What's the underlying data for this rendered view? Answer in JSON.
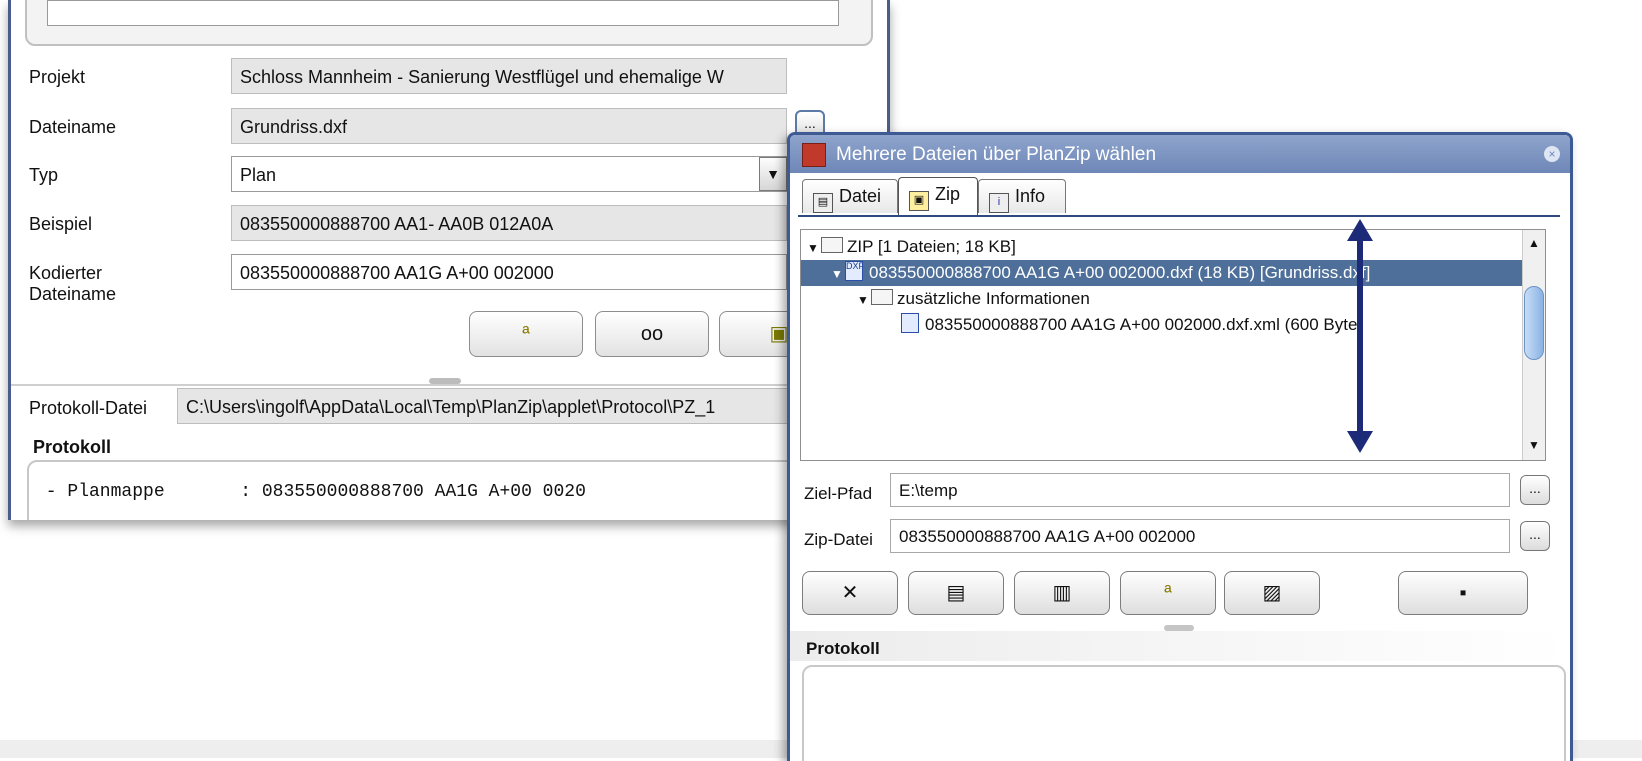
{
  "main": {
    "labels": {
      "project": "Projekt",
      "filename": "Dateiname",
      "type": "Typ",
      "example": "Beispiel",
      "encoded": "Kodierter Dateiname",
      "protocol_file": "Protokoll-Datei",
      "protocol": "Protokoll"
    },
    "values": {
      "project": "Schloss Mannheim - Sanierung Westflügel und ehemalige W",
      "filename": "Grundriss.dxf",
      "type": "Plan",
      "example": "083550000888700 AA1- AA0B 012A0A",
      "encoded": "083550000888700 AA1G A+00 002000",
      "protocol_file": "C:\\Users\\ingolf\\AppData\\Local\\Temp\\PlanZip\\applet\\Protocol\\PZ_1",
      "protocol_line": " - Planmappe       : 083550000888700 AA1G A+00 0020"
    },
    "buttons": {
      "browse": "..."
    },
    "icons": {
      "combo": "▼",
      "btn1": "ª",
      "btn2": "oo",
      "btn3": "▣"
    }
  },
  "dialog": {
    "title": "Mehrere Dateien über PlanZip wählen",
    "close": "×",
    "tabs": [
      {
        "label": "Datei",
        "icon": "▤"
      },
      {
        "label": "Zip",
        "icon": "▣"
      },
      {
        "label": "Info",
        "icon": "i"
      }
    ],
    "tree": {
      "root": "ZIP [1 Dateien; 18 KB]",
      "file": "083550000888700 AA1G A+00 002000.dxf (18 KB) [Grundriss.dxf]",
      "folder": "zusätzliche Informationen",
      "xml": "083550000888700 AA1G A+00 002000.dxf.xml (600 Byte)",
      "toggle_open": "▼",
      "file_icon_text": "DXF"
    },
    "labels": {
      "target": "Ziel-Pfad",
      "zip": "Zip-Datei",
      "protocol": "Protokoll"
    },
    "values": {
      "target": "E:\\temp",
      "zip": "083550000888700 AA1G A+00 002000"
    },
    "buttons": {
      "browse": "..."
    },
    "toolbar": {
      "delete": "✕",
      "paste": "▤",
      "copy": "▥",
      "rename": "ª",
      "view": "▨",
      "save": "▪"
    },
    "scroll": {
      "up": "▲",
      "down": "▼"
    }
  }
}
